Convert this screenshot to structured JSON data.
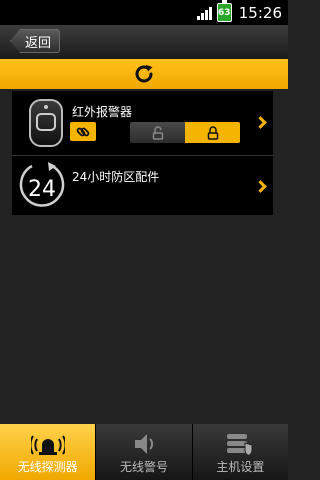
{
  "status_bar": {
    "battery": "63",
    "time": "15:26"
  },
  "header": {
    "back_label": "返回"
  },
  "list": {
    "items": [
      {
        "title": "红外报警器",
        "icon": "motion-sensor-icon"
      },
      {
        "title": "24小时防区配件",
        "icon": "24h-clock-icon"
      }
    ]
  },
  "bottom_nav": {
    "tabs": [
      {
        "label": "无线探测器",
        "icon": "siren-icon",
        "active": true
      },
      {
        "label": "无线警号",
        "icon": "speaker-icon",
        "active": false
      },
      {
        "label": "主机设置",
        "icon": "server-shield-icon",
        "active": false
      }
    ]
  },
  "colors": {
    "accent": "#f5b400",
    "background": "#222222",
    "list_bg": "#000000"
  }
}
